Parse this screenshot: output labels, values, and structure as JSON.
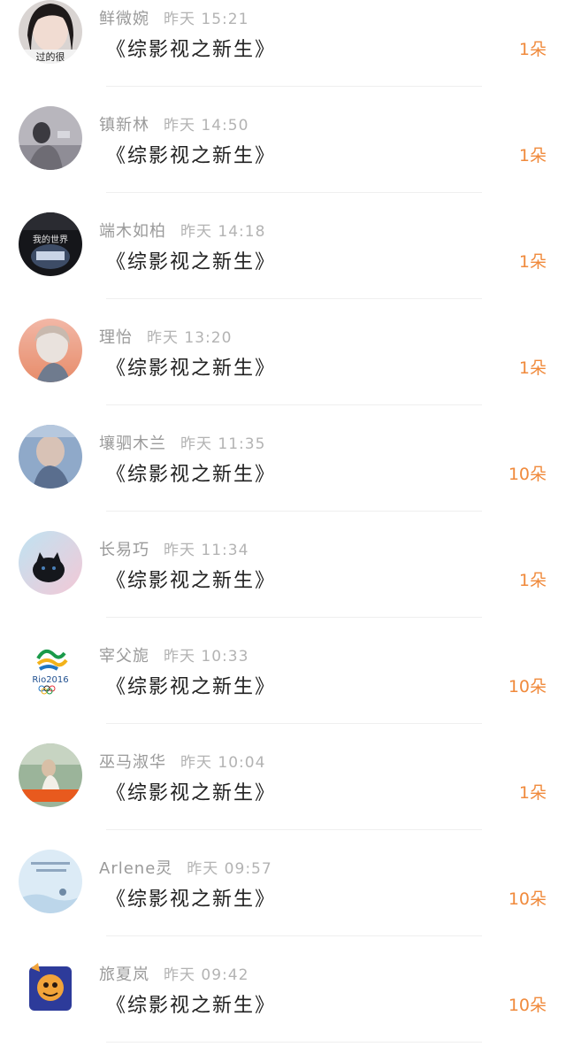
{
  "title": "《综影视之新生》",
  "gifts": [
    {
      "name": "鲜微婉",
      "time": "昨天 15:21",
      "count": "1朵",
      "avatar_caption": "过的很"
    },
    {
      "name": "镇新林",
      "time": "昨天 14:50",
      "count": "1朵"
    },
    {
      "name": "端木如柏",
      "time": "昨天 14:18",
      "count": "1朵",
      "avatar_caption": "我的世界"
    },
    {
      "name": "理怡",
      "time": "昨天 13:20",
      "count": "1朵"
    },
    {
      "name": "壤驷木兰",
      "time": "昨天 11:35",
      "count": "10朵"
    },
    {
      "name": "长易巧",
      "time": "昨天 11:34",
      "count": "1朵"
    },
    {
      "name": "宰父旎",
      "time": "昨天 10:33",
      "count": "10朵",
      "avatar_caption": "Rio2016"
    },
    {
      "name": "巫马淑华",
      "time": "昨天 10:04",
      "count": "1朵"
    },
    {
      "name": "Arlene灵",
      "time": "昨天 09:57",
      "count": "10朵"
    },
    {
      "name": "旅夏岚",
      "time": "昨天 09:42",
      "count": "10朵"
    }
  ],
  "colors": {
    "accent": "#f08a3c",
    "name": "#9a9a9a",
    "title": "#222222",
    "divider": "#efefef"
  }
}
